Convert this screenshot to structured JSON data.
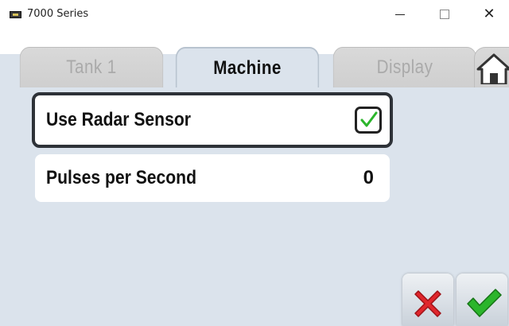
{
  "window": {
    "title": "7000 Series",
    "controls": [
      "minimize",
      "maximize",
      "close"
    ]
  },
  "tabs": [
    {
      "label": "Tank 1",
      "active": false
    },
    {
      "label": "Machine",
      "active": true
    },
    {
      "label": "Display",
      "active": false
    }
  ],
  "home_tab": {
    "icon": "home-icon"
  },
  "settings": [
    {
      "label": "Use Radar Sensor",
      "type": "checkbox",
      "checked": true,
      "selected": true
    },
    {
      "label": "Pulses per Second",
      "type": "number",
      "value": "0",
      "selected": false
    }
  ],
  "actions": {
    "cancel": {
      "icon": "red-x-icon"
    },
    "confirm": {
      "icon": "green-check-icon"
    }
  },
  "colors": {
    "content_bg": "#dbe3ec",
    "check_green": "#2bb52b",
    "cancel_red": "#e0262c"
  }
}
